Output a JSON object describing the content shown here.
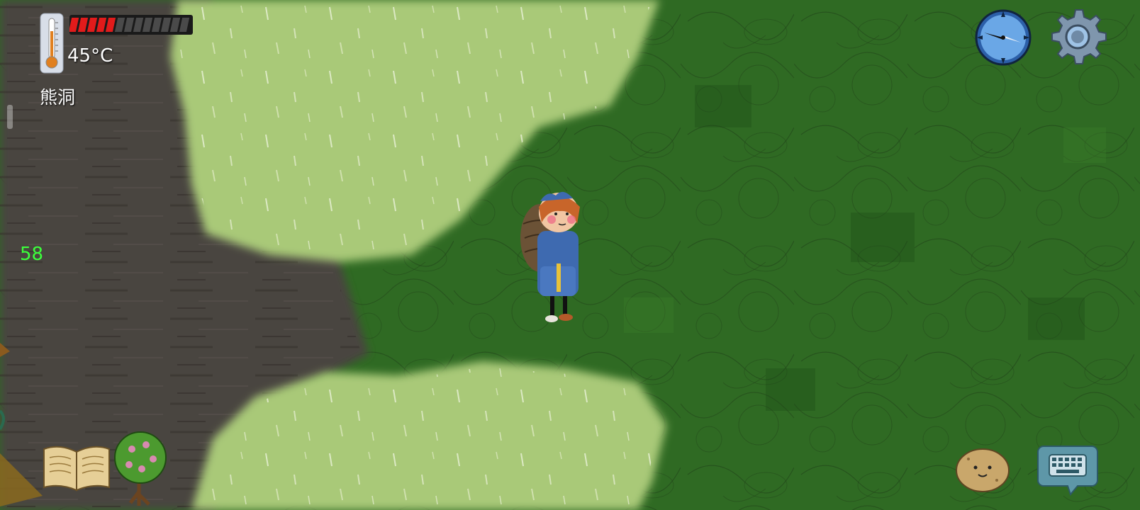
{
  "hud": {
    "temperature": "45°C",
    "location": "熊洞",
    "fps": "58",
    "health": {
      "filled_segments": 5,
      "total_segments": 13,
      "fill_color": "#e21b1b",
      "empty_color": "#4a4a4a"
    }
  },
  "colors": {
    "dirt": "#4a4440",
    "light_grass": "#a9c978",
    "dark_grass": "#2f6a23",
    "fps_text": "#3cff3c"
  },
  "icons": {
    "thermometer": "thermometer-icon",
    "compass": "compass-icon",
    "settings": "gear-icon",
    "journal": "book-icon",
    "emote": "potato-face-icon",
    "chat": "keyboard-chat-icon"
  }
}
